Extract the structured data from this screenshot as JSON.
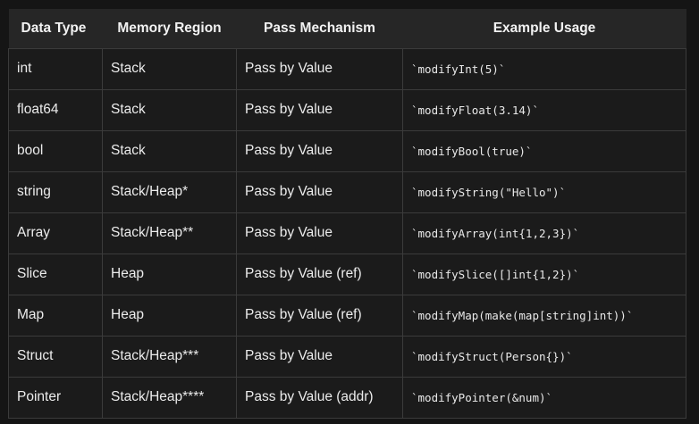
{
  "table": {
    "headers": [
      "Data Type",
      "Memory Region",
      "Pass Mechanism",
      "Example Usage"
    ],
    "rows": [
      [
        "int",
        "Stack",
        "Pass by Value",
        "`modifyInt(5)`"
      ],
      [
        "float64",
        "Stack",
        "Pass by Value",
        "`modifyFloat(3.14)`"
      ],
      [
        "bool",
        "Stack",
        "Pass by Value",
        "`modifyBool(true)`"
      ],
      [
        "string",
        "Stack/Heap*",
        "Pass by Value",
        "`modifyString(\"Hello\")`"
      ],
      [
        "Array",
        "Stack/Heap**",
        "Pass by Value",
        "`modifyArray(int{1,2,3})`"
      ],
      [
        "Slice",
        "Heap",
        "Pass by Value (ref)",
        "`modifySlice([]int{1,2})`"
      ],
      [
        "Map",
        "Heap",
        "Pass by Value (ref)",
        "`modifyMap(make(map[string]int))`"
      ],
      [
        "Struct",
        "Stack/Heap***",
        "Pass by Value",
        "`modifyStruct(Person{})`"
      ],
      [
        "Pointer",
        "Stack/Heap****",
        "Pass by Value (addr)",
        "`modifyPointer(&num)`"
      ]
    ]
  },
  "colors": {
    "page_background": "#151515",
    "header_background": "#262626",
    "row_background": "#1b1b1b",
    "border": "#3b3b3b",
    "text": "#ececec"
  }
}
